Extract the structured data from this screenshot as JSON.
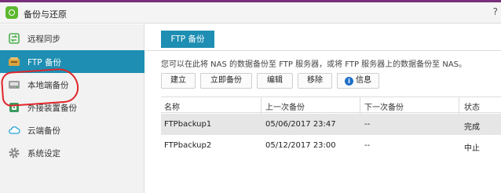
{
  "window": {
    "title": "备份与还原",
    "corner_label": "?"
  },
  "sidebar": {
    "items": [
      {
        "label": "远程同步",
        "icon": "sync-icon"
      },
      {
        "label": "FTP 备份",
        "icon": "ftp-icon"
      },
      {
        "label": "本地端备份",
        "icon": "local-backup-icon"
      },
      {
        "label": "外接装置备份",
        "icon": "external-device-icon"
      },
      {
        "label": "云端备份",
        "icon": "cloud-icon"
      },
      {
        "label": "系统设定",
        "icon": "gear-icon"
      }
    ],
    "active_index": 1
  },
  "main": {
    "tab_label": "FTP 备份",
    "description": "您可以在此将 NAS 的数据备份至 FTP 服务器，或将 FTP 服务器上的数据备份至 NAS。",
    "toolbar": {
      "create": "建立",
      "backup_now": "立即备份",
      "edit": "编辑",
      "remove": "移除",
      "info": "信息"
    },
    "table": {
      "headers": [
        "名称",
        "上一次备份",
        "下一次备份",
        "状态"
      ],
      "rows": [
        {
          "name": "FTPbackup1",
          "last": "05/06/2017 23:47",
          "next": "--",
          "status": "完成",
          "selected": true
        },
        {
          "name": "FTPbackup2",
          "last": "05/12/2017 23:00",
          "next": "--",
          "status": "中止",
          "selected": false
        }
      ]
    }
  },
  "colors": {
    "accent": "#1e8eb3",
    "brand_green": "#5cb82e",
    "title_strip": "#7a2f7c",
    "annotation_red": "#e0262a"
  }
}
